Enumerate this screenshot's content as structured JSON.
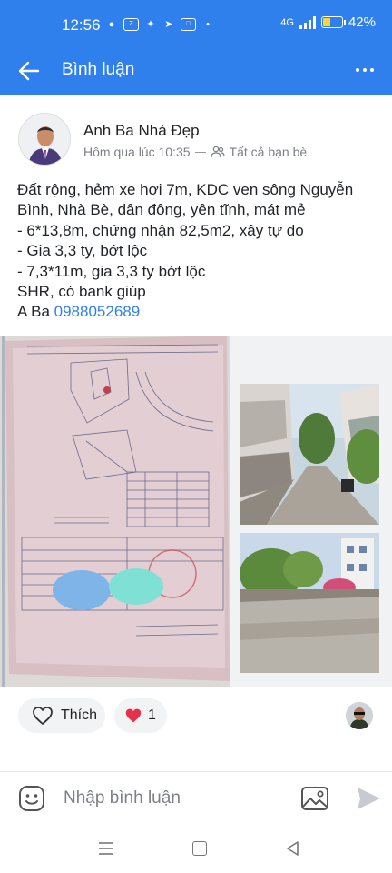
{
  "status_bar": {
    "time": "12:56",
    "network": "4G",
    "battery": "42%",
    "battery_fraction": 0.42
  },
  "header": {
    "title": "Bình luận",
    "back_icon": "arrow-left-icon",
    "more_icon": "more-dots-icon"
  },
  "post": {
    "author": "Anh Ba Nhà Đẹp",
    "time": "Hôm qua lúc 10:35",
    "audience": "Tất cả bạn bè",
    "audience_icon": "friends-icon",
    "lines": [
      "Đất rộng, hẻm xe hơi 7m, KDC ven sông Nguyễn",
      "Bình, Nhà Bè, dân đông, yên tĩnh, mát mẻ",
      "- 6*13,8m, chứng nhận 82,5m2, xây tự do",
      "- Gia 3,3 ty, bớt lộc",
      "- 7,3*11m, gia 3,3 ty bớt lộc",
      "SHR, có bank giúp"
    ],
    "contact_prefix": "A Ba ",
    "phone": "0988052689"
  },
  "reactions": {
    "like_label": "Thích",
    "like_icon": "heart-outline-icon",
    "count_icon": "red-heart-icon",
    "count": "1"
  },
  "comment_bar": {
    "placeholder": "Nhập bình luận",
    "sticker_icon": "sticker-icon",
    "image_icon": "image-icon",
    "send_icon": "send-icon"
  },
  "colors": {
    "brand": "#2f80ed",
    "link": "#2f80ed",
    "heart": "#e8304a"
  }
}
